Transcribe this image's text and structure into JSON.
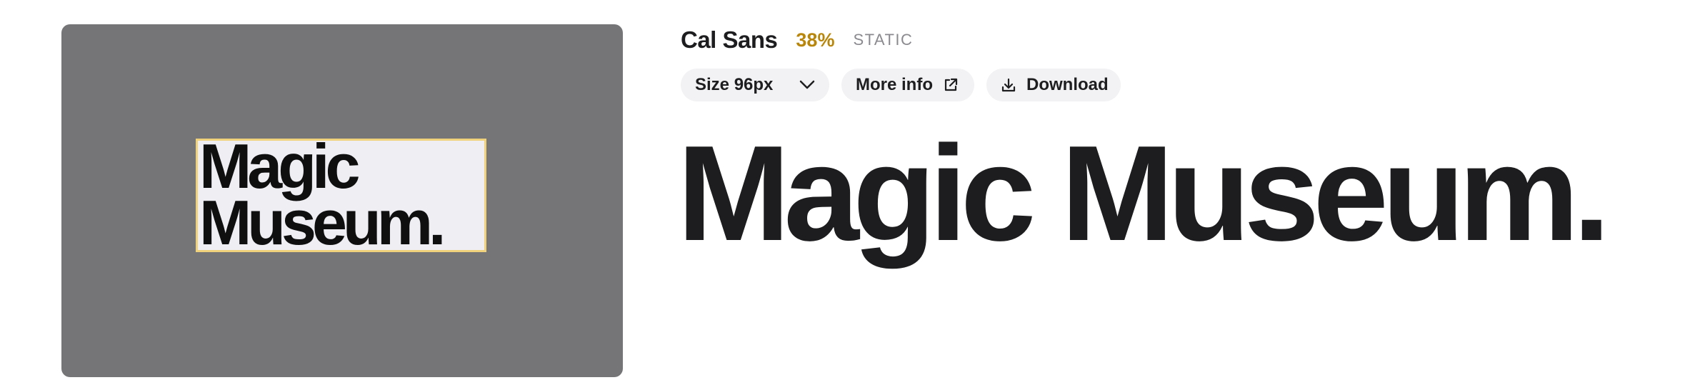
{
  "preview": {
    "text": "Magic\nMuseum."
  },
  "font": {
    "name": "Cal Sans",
    "percent": "38%",
    "tag": "STATIC"
  },
  "controls": {
    "size_label": "Size 96px",
    "more_info_label": "More info",
    "download_label": "Download"
  },
  "sample_text": "Magic Museum.",
  "colors": {
    "preview_bg": "#757577",
    "preview_box_bg": "#efeef3",
    "preview_box_border": "#f1d27c",
    "percent": "#b8860b",
    "pill_bg": "#f2f2f4"
  }
}
